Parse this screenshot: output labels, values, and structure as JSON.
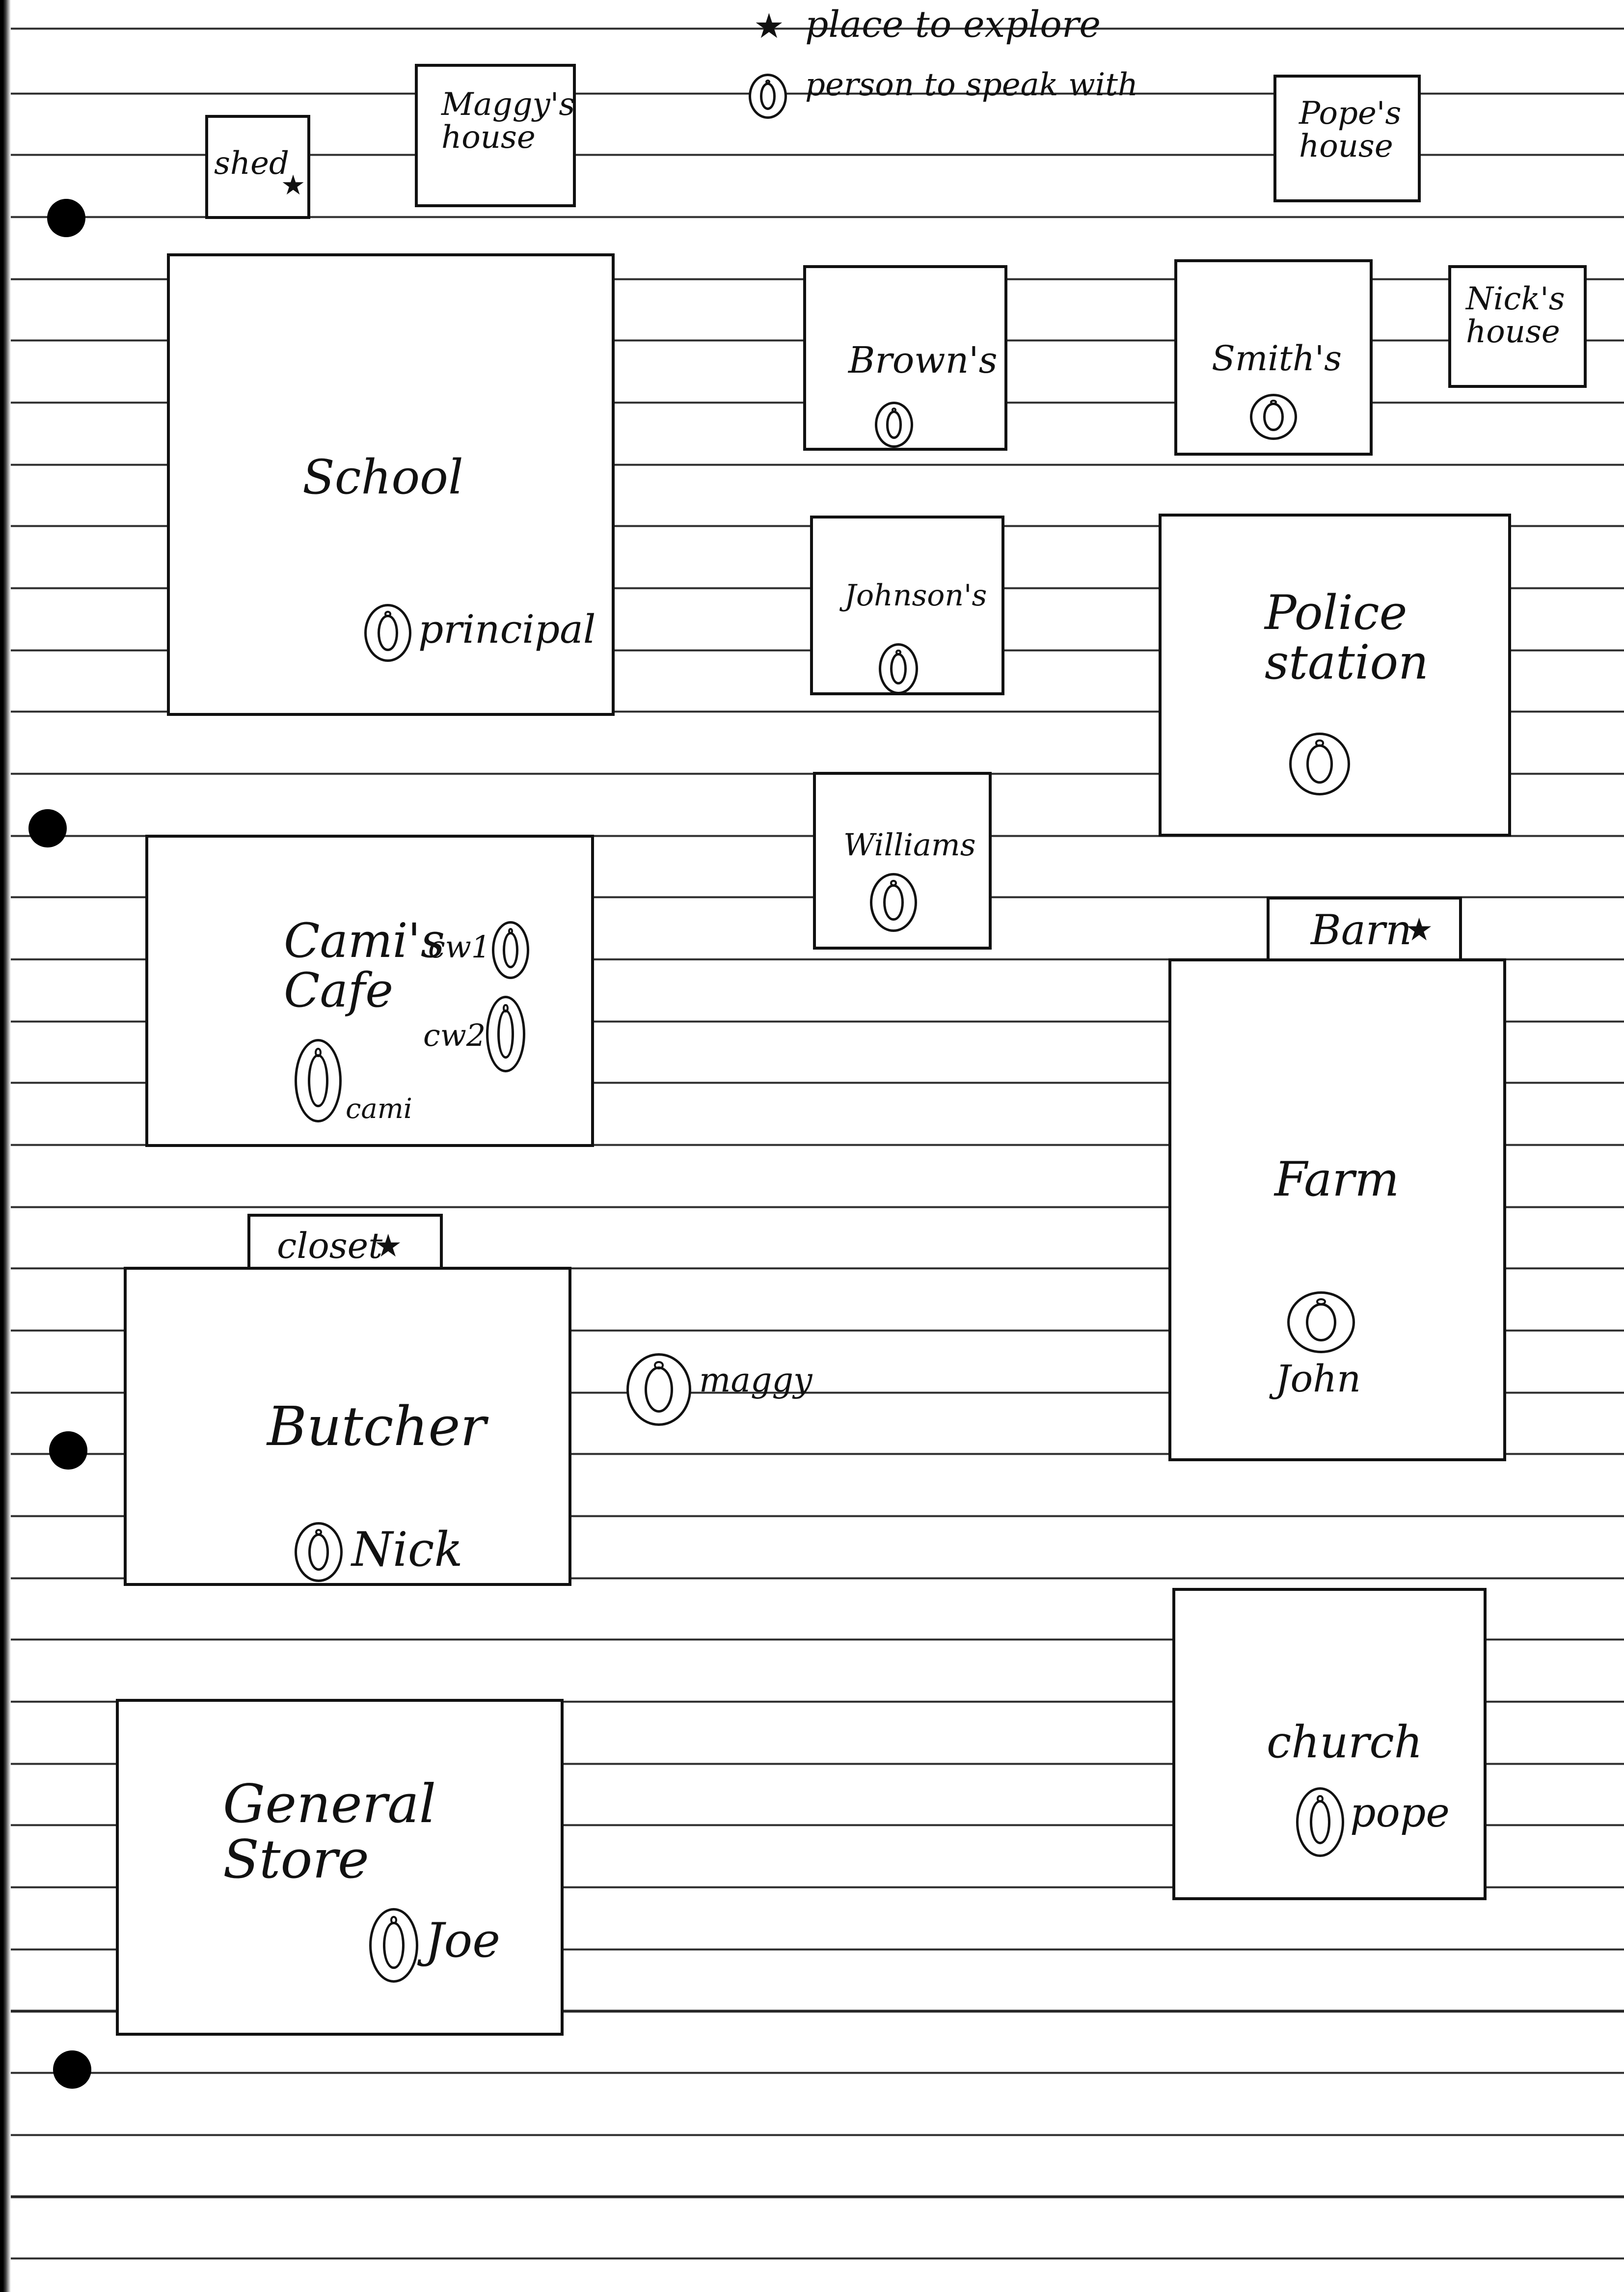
{
  "legend": {
    "explore_label": "place to explore",
    "person_label": "person to speak with",
    "explore_icon": "star-icon",
    "person_icon": "person-circle-icon"
  },
  "locations": {
    "shed": "shed",
    "maggys_house": "Maggy's\nhouse",
    "popes_house": "Pope's\nhouse",
    "school": "School",
    "browns": "Brown's",
    "smiths": "Smith's",
    "nicks_house": "Nick's\nhouse",
    "johnsons": "Johnson's",
    "police_station": "Police\nstation",
    "williams": "Williams",
    "camis_cafe": "Cami's\nCafe",
    "barn": "Barn",
    "farm": "Farm",
    "closet": "closet",
    "butcher": "Butcher",
    "general_store": "General\nStore",
    "church": "church"
  },
  "people": {
    "principal": "principal",
    "cw1": "cw1",
    "cw2": "cw2",
    "cami": "cami",
    "maggy": "maggy",
    "nick": "Nick",
    "john": "John",
    "joe": "Joe",
    "pope": "pope"
  }
}
